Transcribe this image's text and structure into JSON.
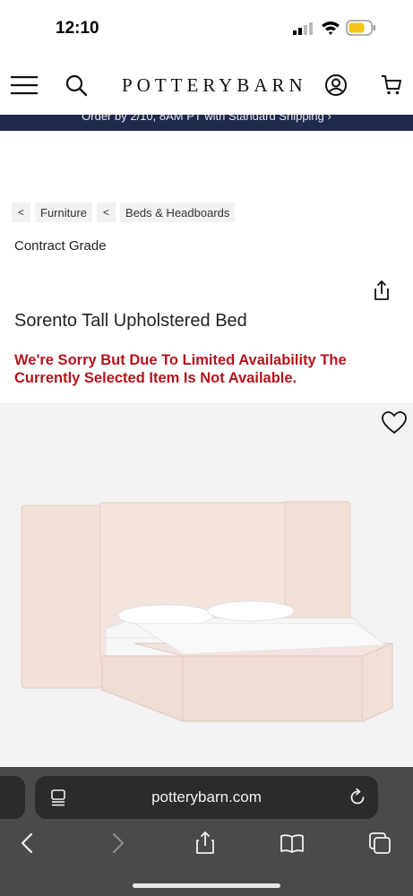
{
  "status_bar": {
    "time": "12:10"
  },
  "header": {
    "logo": "POTTERYBARN"
  },
  "promo": {
    "text": "Order by 2/10, 8AM PT with Standard Shipping ›"
  },
  "breadcrumb": {
    "back_glyph": "<",
    "items": [
      {
        "label": "Furniture"
      },
      {
        "label": "Beds & Headboards"
      }
    ]
  },
  "product": {
    "brand_line": "Contract Grade",
    "title": "Sorento Tall Upholstered Bed",
    "availability": "We're Sorry But Due To Limited Availability The Currently Selected Item Is Not Available."
  },
  "browser": {
    "url": "potterybarn.com"
  },
  "colors": {
    "promo_bg": "#1f2a4d",
    "alert_red": "#b4141c",
    "safari_bar": "#4a4a4c",
    "bed_fabric": "#f3e4de"
  },
  "icons": [
    "menu-icon",
    "search-icon",
    "account-icon",
    "cart-icon",
    "share-icon",
    "heart-icon",
    "page-menu-icon",
    "reload-icon",
    "back-icon",
    "forward-icon",
    "share-sheet-icon",
    "bookmarks-icon",
    "tabs-icon"
  ]
}
